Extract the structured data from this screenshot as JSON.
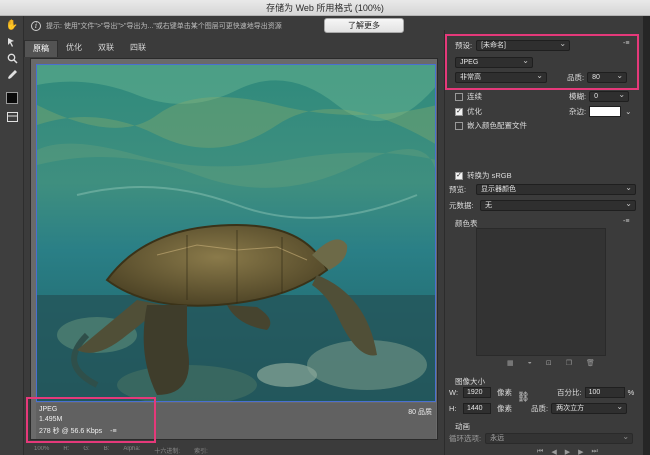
{
  "window": {
    "title": "存储为 Web 所用格式 (100%)"
  },
  "toolbar": {
    "tools": [
      "hand-icon",
      "slice-select-icon",
      "zoom-icon",
      "eyedropper-icon"
    ],
    "color": "#000000"
  },
  "hint": {
    "text": "提示: 使用\"文件\">\"导出\">\"导出为...\"或右键单击某个图层可更快速地导出资源",
    "learn_more": "了解更多"
  },
  "tabs": [
    "原稿",
    "优化",
    "双联",
    "四联"
  ],
  "preview": {
    "format": "JPEG",
    "size": "1.495M",
    "time": "278 秒 @ 56.6 Kbps",
    "time_icon": "-≡",
    "quality": "80 品质"
  },
  "panel": {
    "preset_label": "预设:",
    "preset_value": "[未命名]",
    "format_value": "JPEG",
    "quality_level": "非常高",
    "quality_label": "品质:",
    "quality_value": "80",
    "progressive_label": "连续",
    "blur_label": "模糊:",
    "blur_value": "0",
    "optimized_label": "优化",
    "matte_label": "杂边:",
    "embed_profile_label": "嵌入颜色配置文件",
    "srgb_label": "转换为 sRGB",
    "preview_label": "预览:",
    "preview_value": "显示器颜色",
    "metadata_label": "元数据:",
    "metadata_value": "无",
    "color_table_label": "颜色表",
    "image_size_label": "图像大小",
    "width_label": "W:",
    "width_value": "1920",
    "height_label": "H:",
    "height_value": "1440",
    "unit": "像素",
    "percent_label": "百分比:",
    "percent_value": "100",
    "percent_unit": "%",
    "resample_label": "品质:",
    "resample_value": "两次立方",
    "animation_label": "动画",
    "loop_label": "循环选项:",
    "loop_value": "永远"
  },
  "bottom": {
    "zoom": "100%",
    "items": [
      "R:",
      "G:",
      "B:",
      "Alpha:",
      "十六进制:",
      "索引:"
    ]
  },
  "colors": {
    "highlight": "#e5397a",
    "frame": "#4a6fd1"
  }
}
